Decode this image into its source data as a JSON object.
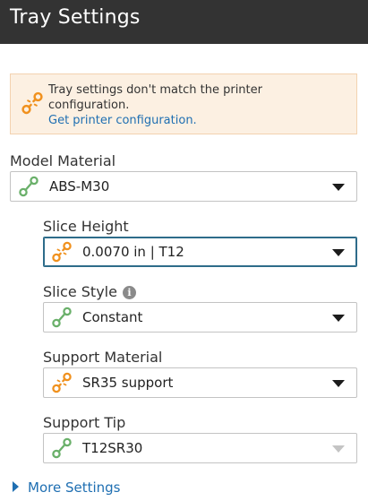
{
  "header": {
    "title": "Tray Settings"
  },
  "alert": {
    "icon": "link-broken-icon",
    "message": "Tray settings don't match the printer configuration.",
    "link": "Get printer configuration."
  },
  "fields": {
    "model_material": {
      "label": "Model Material",
      "value": "ABS-M30",
      "status": "match",
      "icon": "link-icon"
    },
    "slice_height": {
      "label": "Slice Height",
      "value": "0.0070 in | T12",
      "status": "mismatch",
      "icon": "link-broken-icon"
    },
    "slice_style": {
      "label": "Slice Style",
      "value": "Constant",
      "status": "match",
      "icon": "link-icon",
      "info_icon": "i"
    },
    "support_material": {
      "label": "Support Material",
      "value": "SR35 support",
      "status": "mismatch",
      "icon": "link-broken-icon"
    },
    "support_tip": {
      "label": "Support Tip",
      "value": "T12SR30",
      "status": "match",
      "icon": "link-icon",
      "disabled": true
    }
  },
  "more_settings": {
    "label": "More Settings"
  },
  "colors": {
    "header_bg": "#333333",
    "match_green": "#6ab06a",
    "mismatch_orange": "#f0911e",
    "link_blue": "#1f6fb2",
    "alert_bg": "#fcf0e2"
  }
}
